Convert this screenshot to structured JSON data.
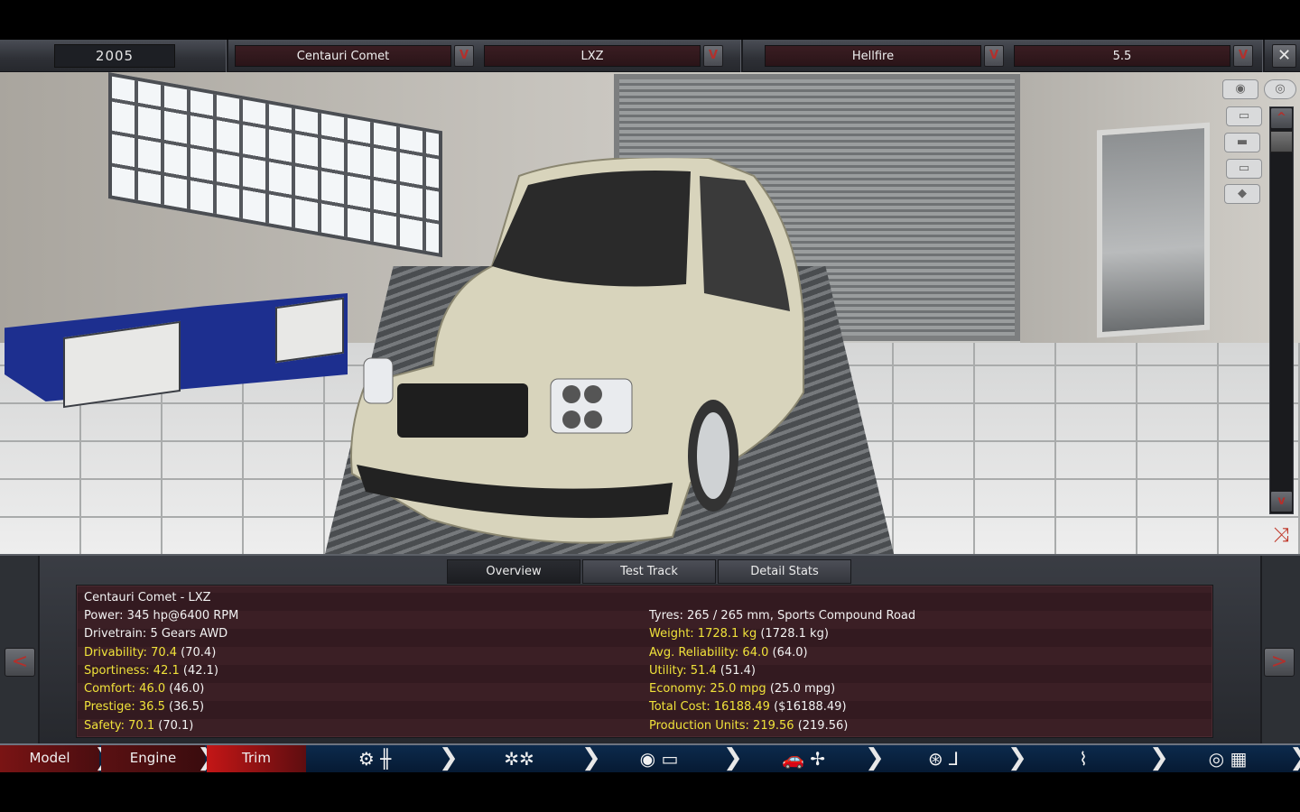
{
  "header": {
    "year": "2005",
    "model_name": "Centauri Comet",
    "trim_name": "LXZ",
    "engine_name": "Hellfire",
    "engine_size": "5.5",
    "dropdown_glyph": "V",
    "close_glyph": "✕"
  },
  "viewport": {
    "camera_icon": "camera-icon",
    "visibility_icon": "eye-icon",
    "view_icons": [
      "front-view-icon",
      "side-view-icon",
      "rear-view-icon",
      "angled-view-icon"
    ],
    "zoom_up_glyph": "^",
    "zoom_down_glyph": "v",
    "reset_glyph": "⤨"
  },
  "tabs": [
    {
      "label": "Overview",
      "active": true
    },
    {
      "label": "Test Track",
      "active": false
    },
    {
      "label": "Detail Stats",
      "active": false
    }
  ],
  "overview": {
    "title": "Centauri Comet - LXZ",
    "left": [
      {
        "key": "Power:",
        "value": "345 hp@6400 RPM",
        "highlight": false
      },
      {
        "key": "Drivetrain:",
        "value": "5 Gears AWD",
        "highlight": false
      },
      {
        "key": "Drivability: 70.4",
        "value": "(70.4)",
        "highlight": true
      },
      {
        "key": "Sportiness: 42.1",
        "value": "(42.1)",
        "highlight": true
      },
      {
        "key": "Comfort: 46.0",
        "value": "(46.0)",
        "highlight": true
      },
      {
        "key": "Prestige: 36.5",
        "value": "(36.5)",
        "highlight": true
      },
      {
        "key": "Safety: 70.1",
        "value": "(70.1)",
        "highlight": true
      }
    ],
    "right": [
      {
        "key": "Tyres:",
        "value": "265 / 265 mm, Sports Compound Road",
        "highlight": false
      },
      {
        "key": "Weight: 1728.1 kg",
        "value": "(1728.1 kg)",
        "highlight": true
      },
      {
        "key": "Avg. Reliability: 64.0",
        "value": "(64.0)",
        "highlight": true
      },
      {
        "key": "Utility: 51.4",
        "value": "(51.4)",
        "highlight": true
      },
      {
        "key": "Economy: 25.0 mpg",
        "value": "(25.0 mpg)",
        "highlight": true
      },
      {
        "key": "Total Cost: 16188.49",
        "value": "($16188.49)",
        "highlight": true
      },
      {
        "key": "Production Units: 219.56",
        "value": "(219.56)",
        "highlight": true
      }
    ]
  },
  "panel_nav": {
    "prev_glyph": "<",
    "next_glyph": ">"
  },
  "bottom_nav": {
    "model_label": "Model",
    "engine_label": "Engine",
    "trim_label": "Trim",
    "icons": [
      {
        "name": "gearbox-icon",
        "glyph": "⚙ ╫"
      },
      {
        "name": "wheels-icon",
        "glyph": "✲✲"
      },
      {
        "name": "brakes-icon",
        "glyph": "◉ ▭"
      },
      {
        "name": "aero-icon",
        "glyph": "🚗 ✢"
      },
      {
        "name": "interior-icon",
        "glyph": "⊛ ⅃"
      },
      {
        "name": "suspension-icon",
        "glyph": "⌇"
      },
      {
        "name": "testing-icon",
        "glyph": "◎ ▦"
      }
    ],
    "chevron_glyph": "❯"
  },
  "colors": {
    "accent_red": "#b3302c",
    "stat_highlight": "#f0e23a",
    "info_bg": "#3b1f25",
    "nav_blue": "#0c2a4c"
  }
}
